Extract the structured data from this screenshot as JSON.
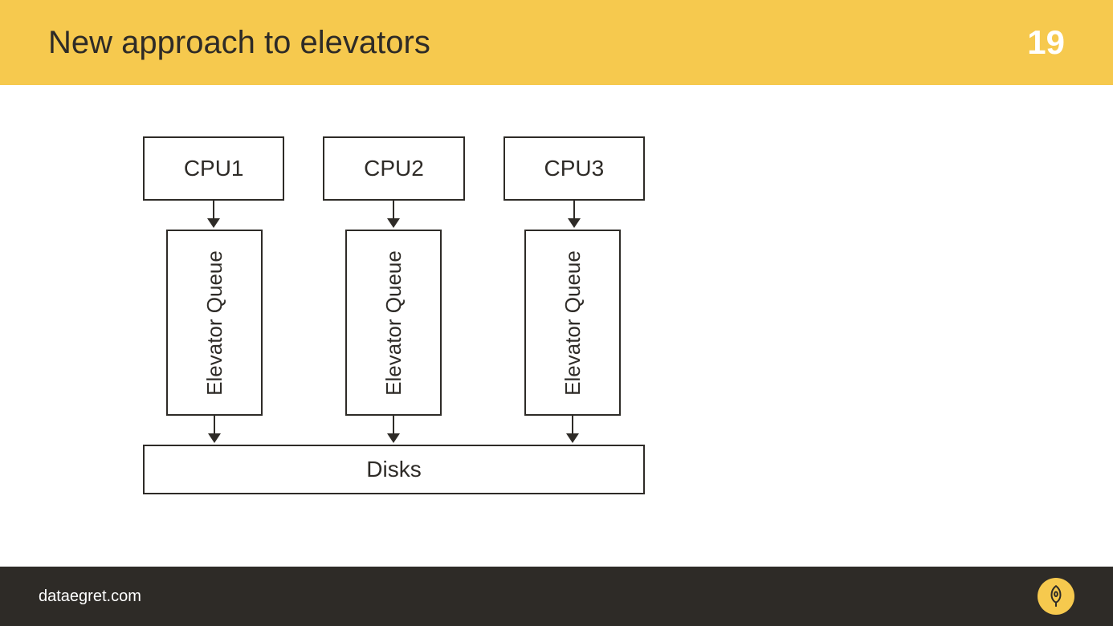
{
  "header": {
    "title": "New approach to elevators",
    "page_number": "19"
  },
  "diagram": {
    "cpus": [
      "CPU1",
      "CPU2",
      "CPU3"
    ],
    "queue_label": "Elevator Queue",
    "disks_label": "Disks"
  },
  "footer": {
    "text": "dataegret.com"
  }
}
